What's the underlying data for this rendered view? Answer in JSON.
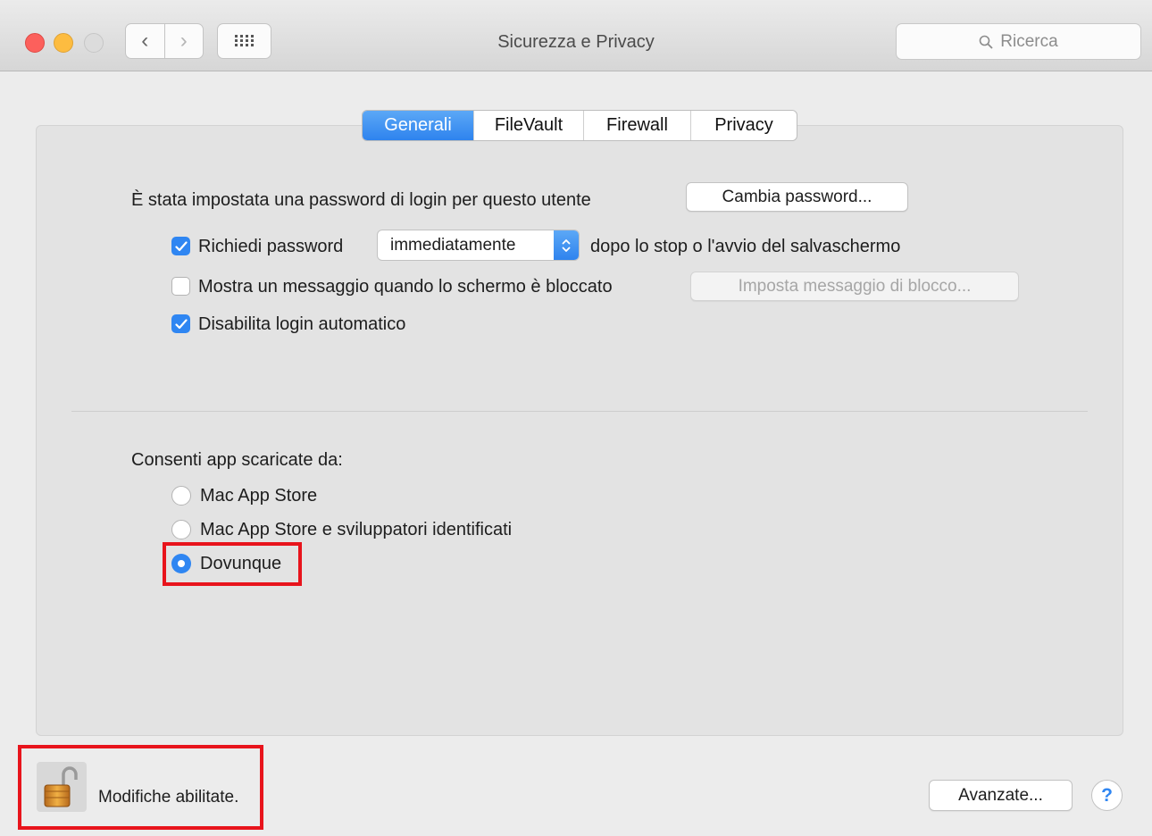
{
  "window": {
    "title": "Sicurezza e Privacy",
    "nav_back": "‹",
    "nav_forward": "›",
    "search_placeholder": "Ricerca"
  },
  "tabs": [
    {
      "label": "Generali",
      "selected": true
    },
    {
      "label": "FileVault",
      "selected": false
    },
    {
      "label": "Firewall",
      "selected": false
    },
    {
      "label": "Privacy",
      "selected": false
    }
  ],
  "general": {
    "password_set_text": "È stata impostata una password di login per questo utente",
    "change_password_button": "Cambia password...",
    "require_password": {
      "label": "Richiedi password",
      "checked": true
    },
    "require_password_delay": "immediatamente",
    "require_password_suffix": "dopo lo stop o l'avvio del salvaschermo",
    "show_message": {
      "label": "Mostra un messaggio quando lo schermo è bloccato",
      "checked": false
    },
    "set_lock_message_button": "Imposta messaggio di blocco...",
    "disable_autologin": {
      "label": "Disabilita login automatico",
      "checked": true
    }
  },
  "allow_apps": {
    "heading": "Consenti app scaricate da:",
    "options": [
      {
        "label": "Mac App Store",
        "selected": false
      },
      {
        "label": "Mac App Store e sviluppatori identificati",
        "selected": false
      },
      {
        "label": "Dovunque",
        "selected": true
      }
    ]
  },
  "footer": {
    "lock_status": "Modifiche abilitate.",
    "advanced_button": "Avanzate...",
    "help_button": "?"
  },
  "colors": {
    "accent": "#2f86f2",
    "highlight": "#e8141c",
    "close": "#fc605c",
    "minimize": "#fdbc40"
  },
  "icons": [
    "close-icon",
    "minimize-icon",
    "zoom-icon",
    "back-icon",
    "forward-icon",
    "show-all-grid-icon",
    "search-icon",
    "checkmark-icon",
    "popup-arrows-icon",
    "unlocked-padlock-icon",
    "help-icon"
  ]
}
